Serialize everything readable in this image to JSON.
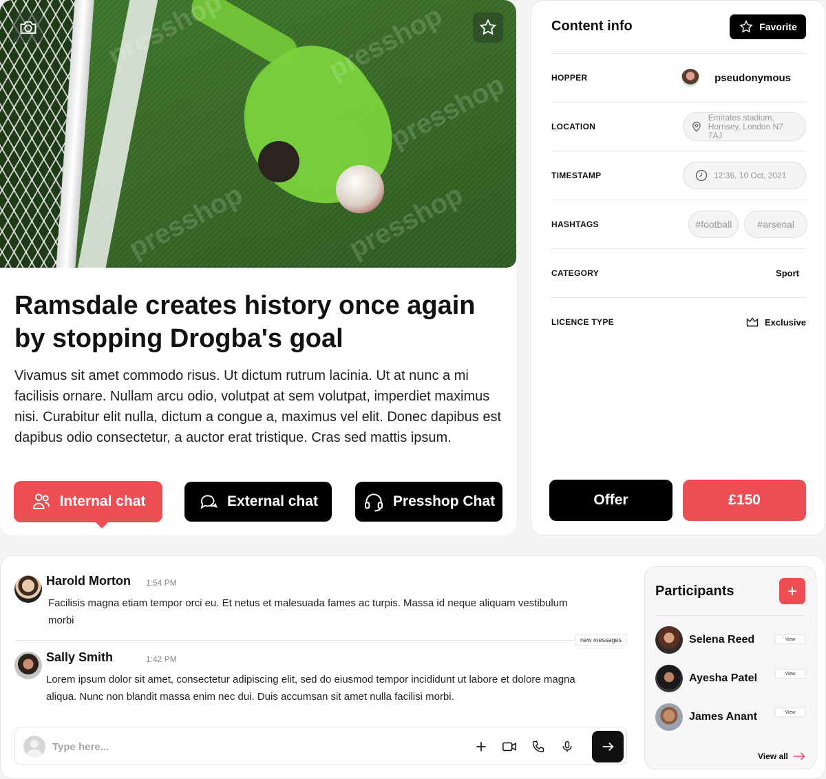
{
  "article": {
    "title": "Ramsdale creates history once again by stopping Drogba's goal",
    "body": "Vivamus sit amet commodo risus. Ut dictum rutrum lacinia. Ut at nunc a mi facilisis ornare. Nullam arcu odio, volutpat at sem volutpat, imperdiet maximus nisi. Curabitur elit nulla, dictum a congue a, maximus vel elit. Donec dapibus est dapibus odio consectetur, a auctor erat tristique. Cras sed mattis ipsum.",
    "watermark": "presshop",
    "buttons": {
      "internal_chat": "Internal chat",
      "external_chat": "External chat",
      "presshop_chat": "Presshop Chat"
    }
  },
  "content_info": {
    "title": "Content info",
    "favorite_label": "Favorite",
    "rows": {
      "hopper": {
        "label": "HOPPER",
        "value": "pseudonymous"
      },
      "location": {
        "label": "LOCATION",
        "value_line1": "Emirates stadium,",
        "value_line2": "Hornsey, London N7 7AJ"
      },
      "timestamp": {
        "label": "TIMESTAMP",
        "value": "12:36, 10 Oct, 2021"
      },
      "hashtags": {
        "label": "HASHTAGS",
        "tags": [
          "#football",
          "#arsenal"
        ]
      },
      "category": {
        "label": "CATEGORY",
        "value": "Sport"
      },
      "licence": {
        "label": "LICENCE TYPE",
        "value": "Exclusive"
      }
    },
    "offer_label": "Offer",
    "price_label": "£150"
  },
  "chat": {
    "messages": [
      {
        "name": "Harold Morton",
        "time": "1:54 PM",
        "text": "Facilisis magna etiam tempor orci eu. Et netus et malesuada fames ac turpis. Massa id neque aliquam vestibulum morbi"
      },
      {
        "name": "Sally Smith",
        "time": "1:42 PM",
        "text": "Lorem ipsum dolor sit amet, consectetur adipiscing elit, sed do eiusmod tempor incididunt ut labore et dolore magna aliqua. Nunc non blandit massa enim nec dui. Duis accumsan sit amet nulla facilisi morbi."
      }
    ],
    "new_messages_label": "new messages",
    "composer_placeholder": "Type here..."
  },
  "participants": {
    "title": "Participants",
    "add_label": "+",
    "list": [
      {
        "name": "Selena Reed",
        "view": "View"
      },
      {
        "name": "Ayesha Patel",
        "view": "View"
      },
      {
        "name": "James Anant",
        "view": "View"
      }
    ],
    "view_all": "View all"
  },
  "colors": {
    "accent": "#ec4e54",
    "dark": "#000000"
  },
  "icons": [
    "camera-icon",
    "star-icon",
    "users-icon",
    "chat-bubbles-icon",
    "headset-icon",
    "location-pin-icon",
    "clock-icon",
    "crown-icon",
    "plus-icon",
    "video-icon",
    "phone-icon",
    "microphone-icon",
    "arrow-right-icon"
  ]
}
